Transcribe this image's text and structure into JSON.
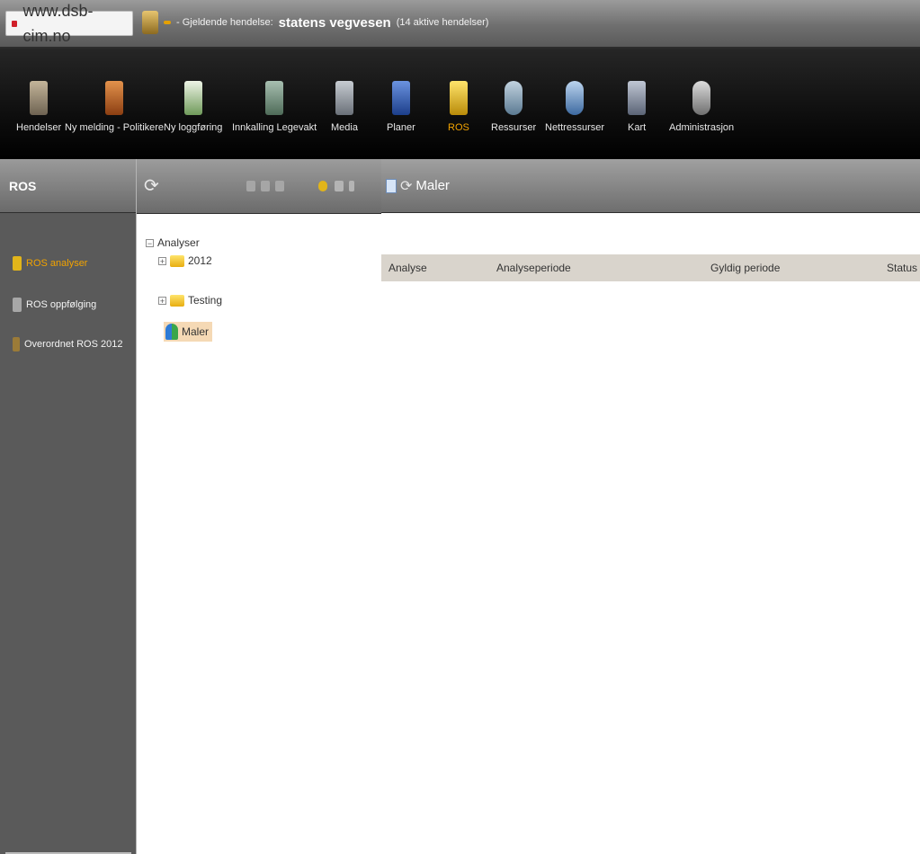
{
  "browser": {
    "url": "www.dsb-cim.no",
    "status_badge": "",
    "status_prefix": "- Gjeldende hendelse:",
    "status_main": "statens vegvesen",
    "status_count": "(14 aktive hendelser)"
  },
  "toolbar": {
    "items": [
      {
        "label": "Hendelser",
        "icon": "events-icon",
        "color": "#9c8c74"
      },
      {
        "label": "Ny melding - Politikere",
        "icon": "new-message-icon",
        "color": "#c96b20"
      },
      {
        "label": "Ny loggføring",
        "icon": "new-log-icon",
        "color": "#7aa36a"
      },
      {
        "label": "Innkalling Legevakt",
        "icon": "summon-icon",
        "color": "#6f8f7a"
      },
      {
        "label": "Media",
        "icon": "media-icon",
        "color": "#8f959c"
      },
      {
        "label": "Planer",
        "icon": "plans-icon",
        "color": "#3b63b5"
      },
      {
        "label": "ROS",
        "icon": "ros-icon",
        "color": "#e2b51a",
        "active": true
      },
      {
        "label": "Ressurser",
        "icon": "resources-icon",
        "color": "#7c99b0"
      },
      {
        "label": "Nettressurser",
        "icon": "web-resources-icon",
        "color": "#6b8eb8"
      },
      {
        "label": "Kart",
        "icon": "map-icon",
        "color": "#7e8aa0"
      },
      {
        "label": "Administrasjon",
        "icon": "admin-gear-icon",
        "color": "#9a9a9a"
      }
    ]
  },
  "left_panel": {
    "title": "ROS",
    "items": [
      {
        "label": "ROS analyser",
        "active": true,
        "color": "#e2b51a"
      },
      {
        "label": "ROS oppfølging",
        "active": false,
        "color": "#a7a7a7"
      },
      {
        "label": "Overordnet ROS 2012",
        "active": false,
        "color": "#9b7b38"
      }
    ]
  },
  "tree": {
    "root": "Analyser",
    "nodes": [
      {
        "label": "2012",
        "type": "folder",
        "expander": "+"
      },
      {
        "label": "Testing",
        "type": "folder",
        "expander": "+"
      },
      {
        "label": "Maler",
        "type": "user",
        "selected": true
      }
    ],
    "root_expander": "−"
  },
  "content": {
    "title": "Maler",
    "columns": [
      "Analyse",
      "Analyseperiode",
      "Gyldig periode",
      "Status"
    ]
  }
}
